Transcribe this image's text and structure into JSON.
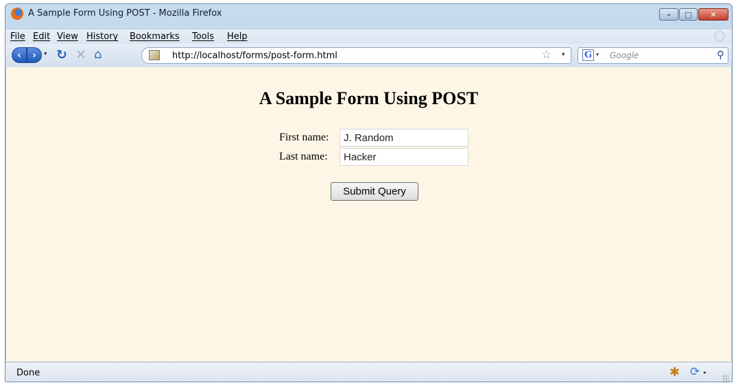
{
  "window": {
    "title": "A Sample Form Using POST - Mozilla Firefox",
    "controls": {
      "minimize": "–",
      "maximize": "□",
      "close": "✕"
    }
  },
  "menubar": {
    "items": [
      {
        "label": "File"
      },
      {
        "label": "Edit"
      },
      {
        "label": "View"
      },
      {
        "label": "History"
      },
      {
        "label": "Bookmarks"
      },
      {
        "label": "Tools"
      },
      {
        "label": "Help"
      }
    ]
  },
  "navbar": {
    "url": "http://localhost/forms/post-form.html",
    "search_placeholder": "Google",
    "icons": {
      "back": "‹",
      "forward": "›",
      "dropdown": "▾",
      "reload": "↻",
      "stop": "✕",
      "home": "⌂",
      "star": "☆",
      "search_engine": "G",
      "search_go": "⚲"
    }
  },
  "page": {
    "title": "A Sample Form Using POST",
    "fields": [
      {
        "label": "First name:",
        "value": "J. Random"
      },
      {
        "label": "Last name:",
        "value": "Hacker"
      }
    ],
    "submit_label": "Submit Query"
  },
  "statusbar": {
    "text": "Done",
    "icons": {
      "addon": "✱",
      "sync": "⟳",
      "sync_drop": "▸"
    }
  },
  "colors": {
    "page_background": "#fdf6e6",
    "window_frame": "#b4cce6",
    "close_button": "#c2402a"
  }
}
